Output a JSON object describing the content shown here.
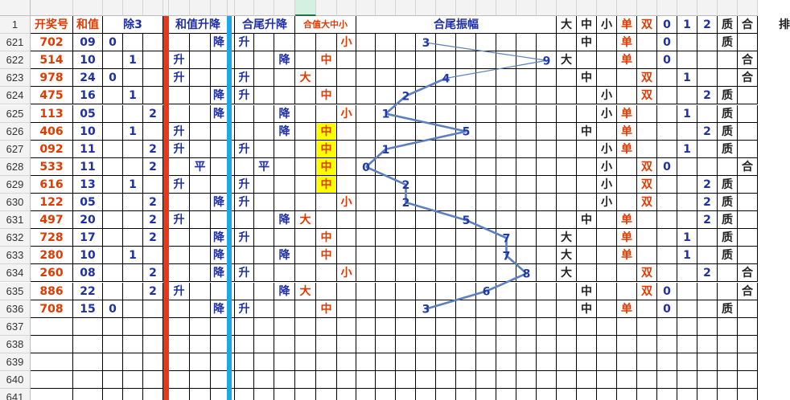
{
  "columns": [
    "A",
    "B",
    "C",
    "D",
    "E",
    "F",
    "G",
    "H",
    "I",
    "J",
    "K",
    "L",
    "M",
    "N",
    "O",
    "P",
    "Q",
    "R",
    "S",
    "T",
    "U",
    "V",
    "W",
    "X",
    "Y",
    "Z",
    "AA",
    "AB",
    "AC",
    "AD",
    "AE",
    "AF",
    "AG",
    "AH",
    "AI",
    "AJ"
  ],
  "active_column": "N",
  "header_row": {
    "row_num": "1",
    "kaijianghao": "开奖号",
    "hezhi": "和值",
    "chu3": "除3",
    "hezhi_shengjiang": "和值升降",
    "hewei_shengjiang": "合尾升降",
    "hezhi_dzx": "合值大中小",
    "hewei_zhenfu": "合尾振幅",
    "da": "大",
    "zhong": "中",
    "xiao": "小",
    "dan": "单",
    "shuang": "双",
    "n0": "0",
    "n1": "1",
    "n2": "2",
    "zhi": "质",
    "he": "合",
    "trailing": "排"
  },
  "rows": [
    {
      "num": "621",
      "code": "702",
      "sum": "09",
      "c3": [
        "0",
        "",
        ""
      ],
      "hsj": [
        "",
        "",
        "降"
      ],
      "wsj": [
        "升",
        "",
        ""
      ],
      "dzx": [
        "",
        "",
        "小"
      ],
      "amp": "3",
      "big": "",
      "mid": "中",
      "small": "",
      "odd": "单",
      "even": "",
      "r": [
        "0",
        "",
        ""
      ],
      "prime": "质",
      "comp": ""
    },
    {
      "num": "622",
      "code": "514",
      "sum": "10",
      "c3": [
        "",
        "1",
        ""
      ],
      "hsj": [
        "升",
        "",
        ""
      ],
      "wsj": [
        "",
        "",
        "降"
      ],
      "dzx": [
        "",
        "中",
        ""
      ],
      "amp": "9",
      "big": "大",
      "mid": "",
      "small": "",
      "odd": "单",
      "even": "",
      "r": [
        "0",
        "",
        ""
      ],
      "prime": "",
      "comp": "合"
    },
    {
      "num": "623",
      "code": "978",
      "sum": "24",
      "c3": [
        "0",
        "",
        ""
      ],
      "hsj": [
        "升",
        "",
        ""
      ],
      "wsj": [
        "升",
        "",
        ""
      ],
      "dzx": [
        "大",
        "",
        ""
      ],
      "amp": "4",
      "big": "",
      "mid": "中",
      "small": "",
      "odd": "",
      "even": "双",
      "r": [
        "",
        "1",
        ""
      ],
      "prime": "",
      "comp": "合"
    },
    {
      "num": "624",
      "code": "475",
      "sum": "16",
      "c3": [
        "",
        "1",
        ""
      ],
      "hsj": [
        "",
        "",
        "降"
      ],
      "wsj": [
        "升",
        "",
        ""
      ],
      "dzx": [
        "",
        "中",
        ""
      ],
      "amp": "2",
      "big": "",
      "mid": "",
      "small": "小",
      "odd": "",
      "even": "双",
      "r": [
        "",
        "",
        "2"
      ],
      "prime": "质",
      "comp": ""
    },
    {
      "num": "625",
      "code": "113",
      "sum": "05",
      "c3": [
        "",
        "",
        "2"
      ],
      "hsj": [
        "",
        "",
        "降"
      ],
      "wsj": [
        "",
        "",
        "降"
      ],
      "dzx": [
        "",
        "",
        "小"
      ],
      "amp": "1",
      "big": "",
      "mid": "",
      "small": "小",
      "odd": "单",
      "even": "",
      "r": [
        "",
        "1",
        ""
      ],
      "prime": "质",
      "comp": ""
    },
    {
      "num": "626",
      "code": "406",
      "sum": "10",
      "c3": [
        "",
        "1",
        ""
      ],
      "hsj": [
        "升",
        "",
        ""
      ],
      "wsj": [
        "",
        "",
        "降"
      ],
      "dzx": [
        "",
        "中",
        ""
      ],
      "amp": "5",
      "big": "",
      "mid": "中",
      "small": "",
      "odd": "单",
      "even": "",
      "r": [
        "",
        "",
        "2"
      ],
      "prime": "质",
      "comp": ""
    },
    {
      "num": "627",
      "code": "092",
      "sum": "11",
      "c3": [
        "",
        "",
        "2"
      ],
      "hsj": [
        "升",
        "",
        ""
      ],
      "wsj": [
        "升",
        "",
        ""
      ],
      "dzx": [
        "",
        "中",
        ""
      ],
      "amp": "1",
      "big": "",
      "mid": "",
      "small": "小",
      "odd": "单",
      "even": "",
      "r": [
        "",
        "1",
        ""
      ],
      "prime": "质",
      "comp": ""
    },
    {
      "num": "628",
      "code": "533",
      "sum": "11",
      "c3": [
        "",
        "",
        "2"
      ],
      "hsj": [
        "",
        "平",
        ""
      ],
      "wsj": [
        "",
        "平",
        ""
      ],
      "dzx": [
        "",
        "中",
        ""
      ],
      "amp": "0",
      "big": "",
      "mid": "",
      "small": "小",
      "odd": "",
      "even": "双",
      "r": [
        "0",
        "",
        ""
      ],
      "prime": "",
      "comp": "合"
    },
    {
      "num": "629",
      "code": "616",
      "sum": "13",
      "c3": [
        "",
        "1",
        ""
      ],
      "hsj": [
        "升",
        "",
        ""
      ],
      "wsj": [
        "升",
        "",
        ""
      ],
      "dzx": [
        "",
        "中",
        ""
      ],
      "amp": "2",
      "big": "",
      "mid": "",
      "small": "小",
      "odd": "",
      "even": "双",
      "r": [
        "",
        "",
        "2"
      ],
      "prime": "质",
      "comp": ""
    },
    {
      "num": "630",
      "code": "122",
      "sum": "05",
      "c3": [
        "",
        "",
        "2"
      ],
      "hsj": [
        "",
        "",
        "降"
      ],
      "wsj": [
        "升",
        "",
        ""
      ],
      "dzx": [
        "",
        "",
        "小"
      ],
      "amp": "2",
      "big": "",
      "mid": "",
      "small": "小",
      "odd": "",
      "even": "双",
      "r": [
        "",
        "",
        "2"
      ],
      "prime": "质",
      "comp": ""
    },
    {
      "num": "631",
      "code": "497",
      "sum": "20",
      "c3": [
        "",
        "",
        "2"
      ],
      "hsj": [
        "升",
        "",
        ""
      ],
      "wsj": [
        "",
        "",
        "降"
      ],
      "dzx": [
        "大",
        "",
        ""
      ],
      "amp": "5",
      "big": "",
      "mid": "中",
      "small": "",
      "odd": "单",
      "even": "",
      "r": [
        "",
        "",
        "2"
      ],
      "prime": "质",
      "comp": ""
    },
    {
      "num": "632",
      "code": "728",
      "sum": "17",
      "c3": [
        "",
        "",
        "2"
      ],
      "hsj": [
        "",
        "",
        "降"
      ],
      "wsj": [
        "升",
        "",
        ""
      ],
      "dzx": [
        "",
        "中",
        ""
      ],
      "amp": "7",
      "big": "大",
      "mid": "",
      "small": "",
      "odd": "单",
      "even": "",
      "r": [
        "",
        "1",
        ""
      ],
      "prime": "质",
      "comp": ""
    },
    {
      "num": "633",
      "code": "280",
      "sum": "10",
      "c3": [
        "",
        "1",
        ""
      ],
      "hsj": [
        "",
        "",
        "降"
      ],
      "wsj": [
        "",
        "",
        "降"
      ],
      "dzx": [
        "",
        "中",
        ""
      ],
      "amp": "7",
      "big": "大",
      "mid": "",
      "small": "",
      "odd": "单",
      "even": "",
      "r": [
        "",
        "1",
        ""
      ],
      "prime": "质",
      "comp": ""
    },
    {
      "num": "634",
      "code": "260",
      "sum": "08",
      "c3": [
        "",
        "",
        "2"
      ],
      "hsj": [
        "",
        "",
        "降"
      ],
      "wsj": [
        "升",
        "",
        ""
      ],
      "dzx": [
        "",
        "",
        "小"
      ],
      "amp": "8",
      "big": "大",
      "mid": "",
      "small": "",
      "odd": "",
      "even": "双",
      "r": [
        "",
        "",
        "2"
      ],
      "prime": "",
      "comp": "合"
    },
    {
      "num": "635",
      "code": "886",
      "sum": "22",
      "c3": [
        "",
        "",
        "2"
      ],
      "hsj": [
        "升",
        "",
        ""
      ],
      "wsj": [
        "",
        "",
        "降"
      ],
      "dzx": [
        "大",
        "",
        ""
      ],
      "amp": "6",
      "big": "",
      "mid": "中",
      "small": "",
      "odd": "",
      "even": "双",
      "r": [
        "0",
        "",
        ""
      ],
      "prime": "",
      "comp": "合"
    },
    {
      "num": "636",
      "code": "708",
      "sum": "15",
      "c3": [
        "0",
        "",
        ""
      ],
      "hsj": [
        "",
        "",
        "降"
      ],
      "wsj": [
        "升",
        "",
        ""
      ],
      "dzx": [
        "",
        "中",
        ""
      ],
      "amp": "3",
      "big": "",
      "mid": "中",
      "small": "",
      "odd": "单",
      "even": "",
      "r": [
        "0",
        "",
        ""
      ],
      "prime": "质",
      "comp": ""
    }
  ],
  "highlighted_rows": [
    "626",
    "627",
    "628",
    "629"
  ],
  "empty_rows": [
    "637",
    "638",
    "639",
    "640",
    "641"
  ],
  "colors": {
    "red": "#e03a00",
    "blue": "#1f2fa8",
    "highlight": "#ffff00",
    "divider_red": "#e8371b",
    "divider_blue": "#1ea7e6",
    "line": "#5b7fbf",
    "active_col": "#217346"
  }
}
